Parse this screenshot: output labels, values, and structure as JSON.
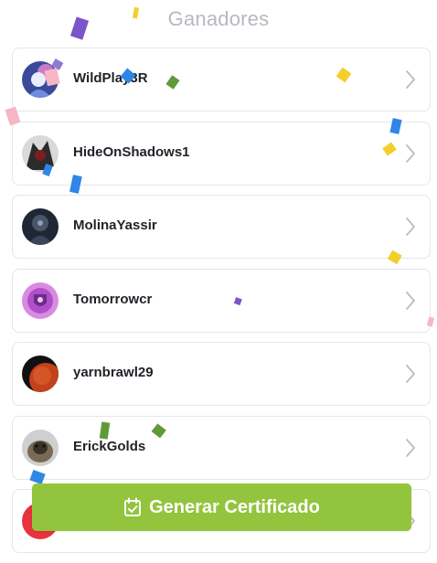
{
  "header": {
    "title": "Ganadores"
  },
  "winners": [
    {
      "name": "WildPlay3R"
    },
    {
      "name": "HideOnShadows1"
    },
    {
      "name": "MolinaYassir"
    },
    {
      "name": "Tomorrowcr"
    },
    {
      "name": "yarnbrawl29"
    },
    {
      "name": "ErickGolds"
    },
    {
      "name": ""
    }
  ],
  "cta": {
    "label": "Generar Certificado",
    "icon": "calendar-check-icon",
    "color": "#93c43d"
  },
  "colors": {
    "title": "#b5b9c0",
    "border": "#e4e6ea",
    "text": "#1f2228",
    "chevron": "#b9bcc2"
  }
}
